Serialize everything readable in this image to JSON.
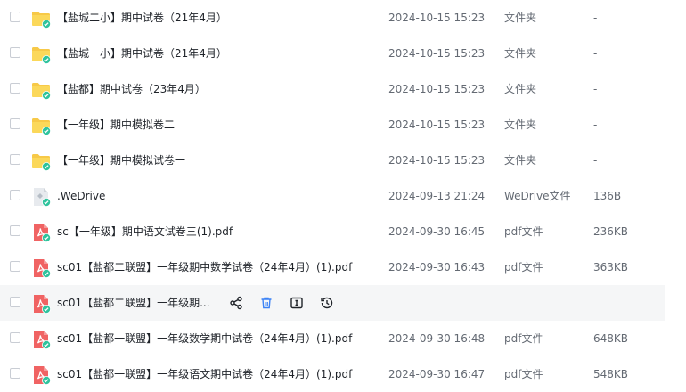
{
  "files": [
    {
      "name": "【盐城二小】期中试卷（21年4月）",
      "date": "2024-10-15 15:23",
      "type": "文件夹",
      "size": "-",
      "icon": "folder-icon"
    },
    {
      "name": "【盐城一小】期中试卷（21年4月）",
      "date": "2024-10-15 15:23",
      "type": "文件夹",
      "size": "-",
      "icon": "folder-icon"
    },
    {
      "name": "【盐都】期中试卷（23年4月）",
      "date": "2024-10-15 15:23",
      "type": "文件夹",
      "size": "-",
      "icon": "folder-icon"
    },
    {
      "name": "【一年级】期中模拟卷二",
      "date": "2024-10-15 15:23",
      "type": "文件夹",
      "size": "-",
      "icon": "folder-icon"
    },
    {
      "name": "【一年级】期中模拟试卷一",
      "date": "2024-10-15 15:23",
      "type": "文件夹",
      "size": "-",
      "icon": "folder-icon"
    },
    {
      "name": ".WeDrive",
      "date": "2024-09-13 21:24",
      "type": "WeDrive文件",
      "size": "136B",
      "icon": "wedrive-file-icon"
    },
    {
      "name": "sc【一年级】期中语文试卷三(1).pdf",
      "date": "2024-09-30 16:45",
      "type": "pdf文件",
      "size": "236KB",
      "icon": "pdf-icon"
    },
    {
      "name": "sc01【盐都二联盟】一年级期中数学试卷（24年4月）(1).pdf",
      "date": "2024-09-30 16:43",
      "type": "pdf文件",
      "size": "363KB",
      "icon": "pdf-icon"
    },
    {
      "name": "sc01【盐都二联盟】一年级期...",
      "date": "",
      "type": "",
      "size": "",
      "icon": "pdf-icon"
    },
    {
      "name": "sc01【盐都一联盟】一年级数学期中试卷（24年4月）(1).pdf",
      "date": "2024-09-30 16:48",
      "type": "pdf文件",
      "size": "648KB",
      "icon": "pdf-icon"
    },
    {
      "name": "sc01【盐都一联盟】一年级语文期中试卷（24年4月）(1).pdf",
      "date": "2024-09-30 16:47",
      "type": "pdf文件",
      "size": "548KB",
      "icon": "pdf-icon"
    }
  ],
  "hover_actions": [
    "share-icon",
    "delete-icon",
    "rename-icon",
    "history-icon"
  ],
  "colors": {
    "folder": "#f7c948",
    "pdf": "#f06363",
    "sync_badge": "#2fc39d",
    "accent_blue": "#3b82f6"
  }
}
